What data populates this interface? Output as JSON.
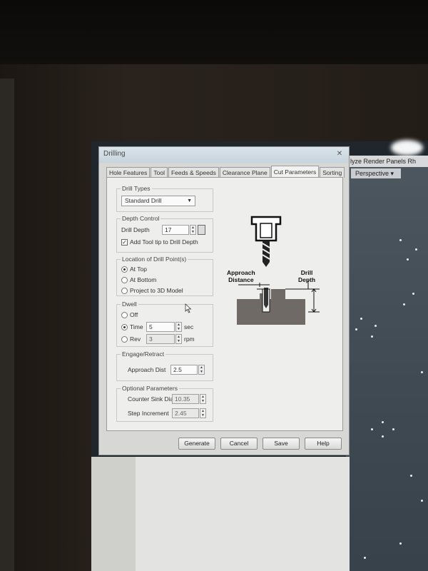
{
  "viewport": {
    "menu": "lyze  Render  Panels  Rh",
    "view_label": "Perspective ▾"
  },
  "dialog": {
    "title": "Drilling",
    "close_glyph": "✕",
    "tabs": [
      "Hole Features",
      "Tool",
      "Feeds & Speeds",
      "Clearance Plane",
      "Cut Parameters",
      "Sorting"
    ],
    "active_tab": "Cut Parameters",
    "drill_types": {
      "legend": "Drill Types",
      "selected": "Standard Drill"
    },
    "depth_control": {
      "legend": "Depth Control",
      "drill_depth_label": "Drill Depth",
      "drill_depth_value": "17",
      "add_tool_tip_label": "Add Tool tip to Drill Depth",
      "add_tool_tip_checked": true
    },
    "location": {
      "legend": "Location of Drill Point(s)",
      "options": [
        "At Top",
        "At Bottom",
        "Project to 3D Model"
      ],
      "selected": "At Top"
    },
    "dwell": {
      "legend": "Dwell",
      "off_label": "Off",
      "time_label": "Time",
      "time_value": "5",
      "time_unit": "sec",
      "rev_label": "Rev",
      "rev_value": "3",
      "rev_unit": "rpm",
      "selected": "Time"
    },
    "engage": {
      "legend": "Engage/Retract",
      "approach_label": "Approach Dist",
      "approach_value": "2.5"
    },
    "optional": {
      "legend": "Optional Parameters",
      "counter_sink_label": "Counter Sink Dia.",
      "counter_sink_value": "10.35",
      "step_increment_label": "Step Increment",
      "step_increment_value": "2.45"
    },
    "diagram": {
      "approach_label_line1": "Approach",
      "approach_label_line2": "Distance",
      "depth_label_line1": "Drill",
      "depth_label_line2": "Depth"
    },
    "buttons": {
      "generate": "Generate",
      "cancel": "Cancel",
      "save": "Save",
      "help": "Help"
    }
  }
}
